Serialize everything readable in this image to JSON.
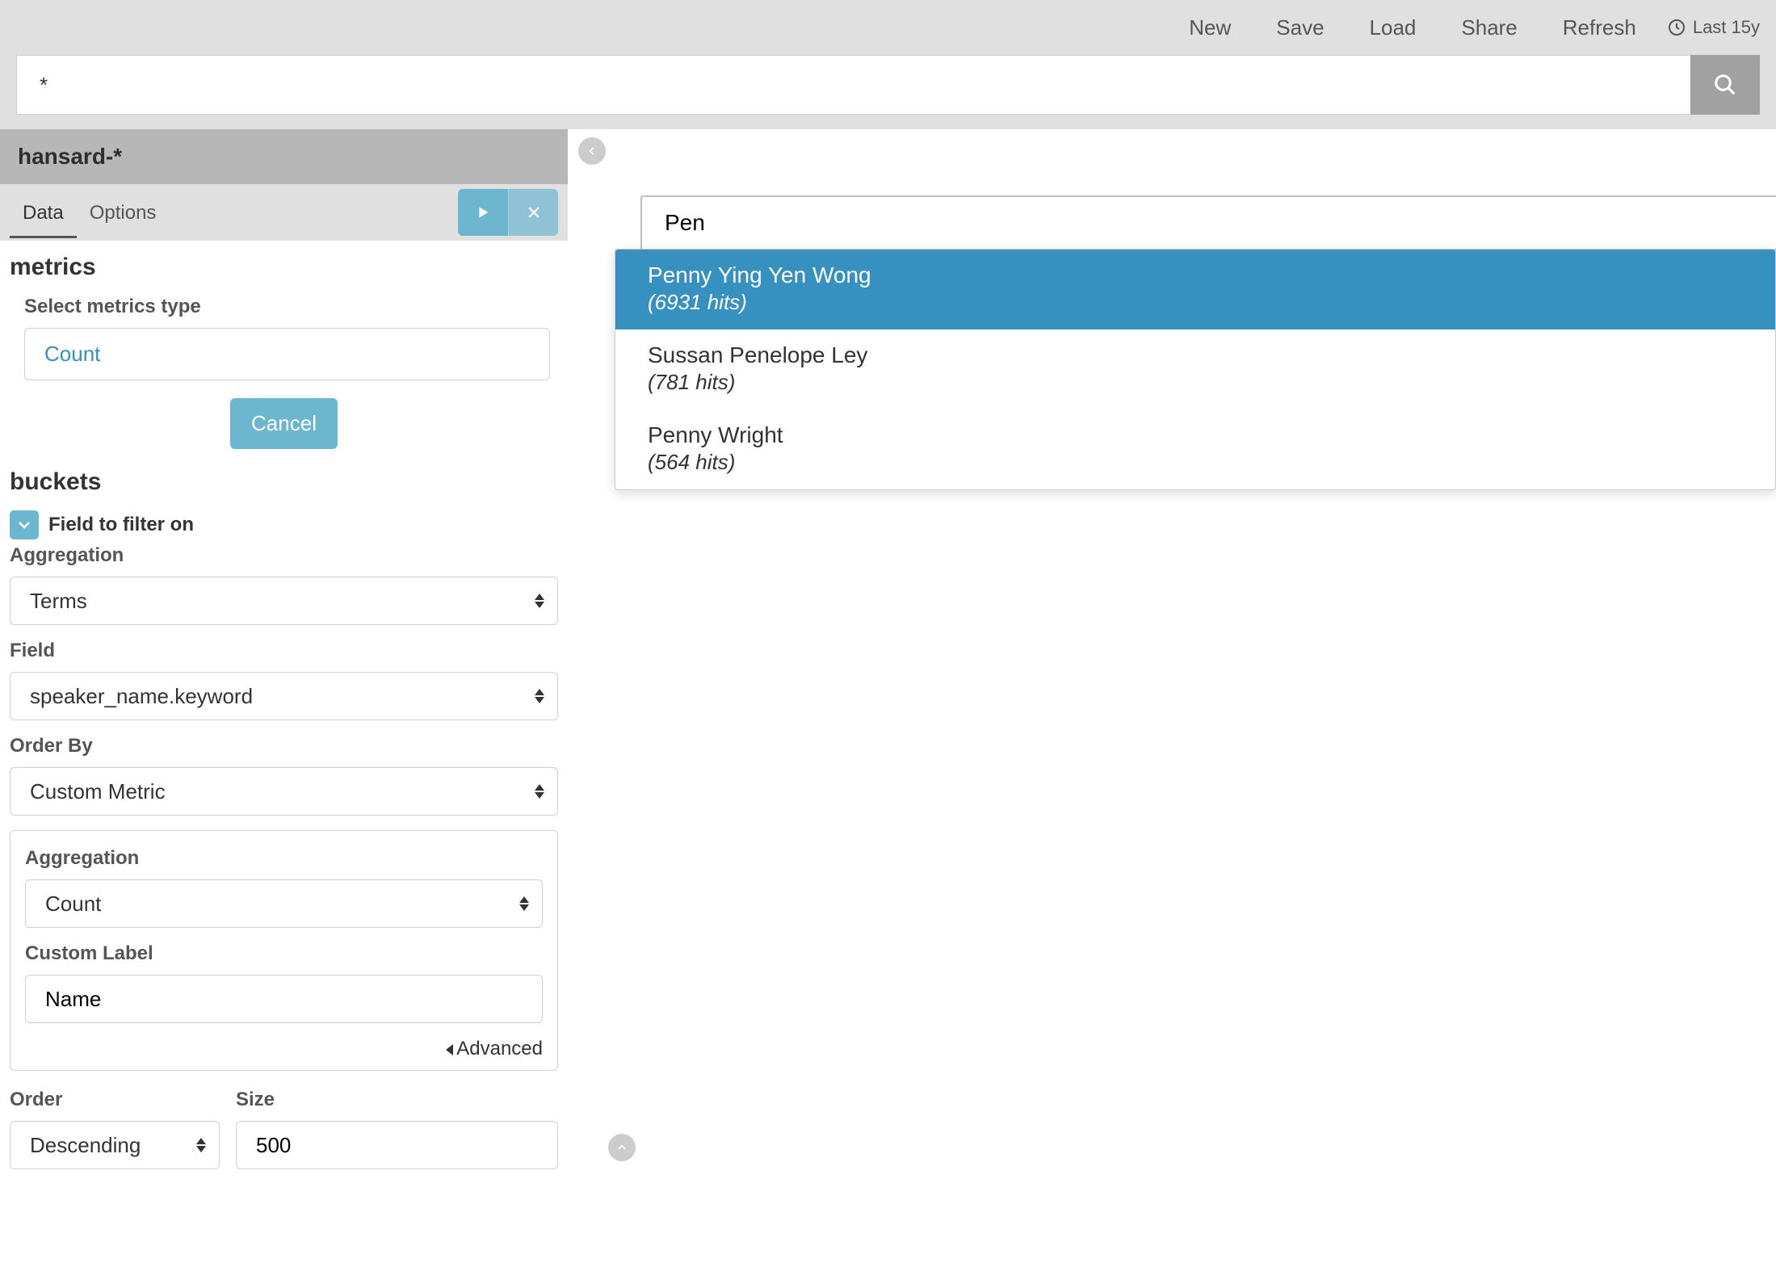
{
  "topbar": {
    "items": [
      "New",
      "Save",
      "Load",
      "Share",
      "Refresh"
    ],
    "time_range": "Last 15y"
  },
  "search": {
    "value": "*"
  },
  "index_pattern": "hansard-*",
  "tabs": {
    "data": "Data",
    "options": "Options",
    "active": "Data"
  },
  "metrics": {
    "heading": "metrics",
    "select_label": "Select metrics type",
    "count_label": "Count",
    "cancel_label": "Cancel"
  },
  "buckets": {
    "heading": "buckets",
    "filter_label": "Field to filter on",
    "aggregation_label": "Aggregation",
    "aggregation_value": "Terms",
    "field_label": "Field",
    "field_value": "speaker_name.keyword",
    "orderby_label": "Order By",
    "orderby_value": "Custom Metric",
    "sub": {
      "aggregation_label": "Aggregation",
      "aggregation_value": "Count",
      "custom_label_label": "Custom Label",
      "custom_label_value": "Name",
      "advanced_label": "Advanced"
    },
    "order_label": "Order",
    "order_value": "Descending",
    "size_label": "Size",
    "size_value": "500"
  },
  "autocomplete": {
    "input_value": "Pen",
    "results": [
      {
        "name": "Penny Ying Yen Wong",
        "hits": "(6931 hits)",
        "selected": true
      },
      {
        "name": "Sussan Penelope Ley",
        "hits": "(781 hits)",
        "selected": false
      },
      {
        "name": "Penny Wright",
        "hits": "(564 hits)",
        "selected": false
      }
    ]
  }
}
